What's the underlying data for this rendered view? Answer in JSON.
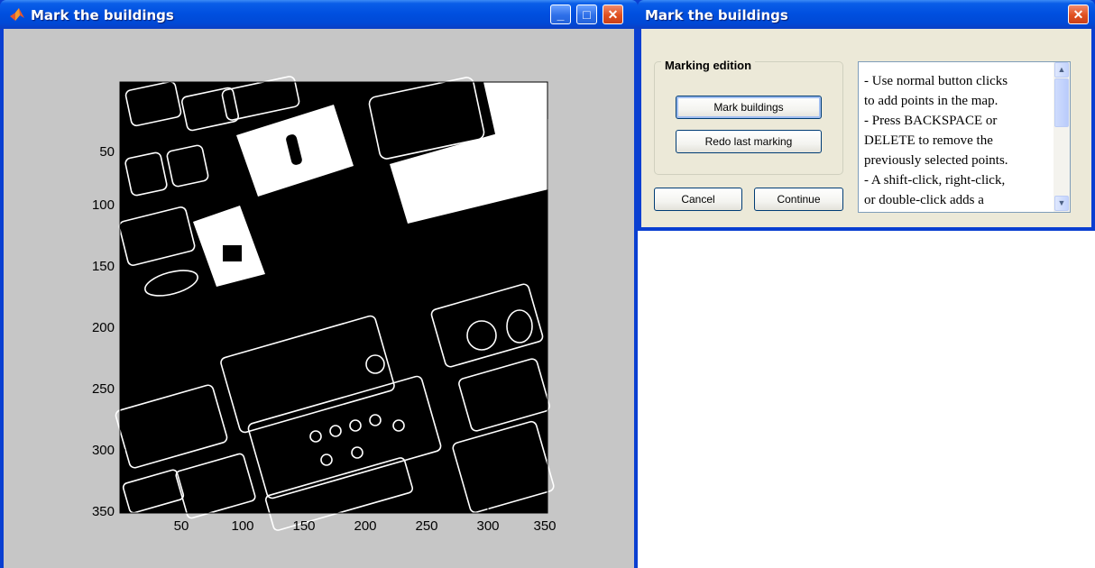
{
  "figure_window": {
    "title": "Mark the buildings",
    "icons": {
      "app": "matlab-icon",
      "minimize": "minimize-icon",
      "maximize": "maximize-icon",
      "close": "close-icon"
    }
  },
  "axes": {
    "x_ticks": [
      "50",
      "100",
      "150",
      "200",
      "250",
      "300",
      "350"
    ],
    "y_ticks": [
      "50",
      "100",
      "150",
      "200",
      "250",
      "300",
      "350"
    ]
  },
  "dialog": {
    "title": "Mark the buildings",
    "group_label": "Marking edition",
    "mark_button": "Mark buildings",
    "redo_button": "Redo last marking",
    "cancel_button": "Cancel",
    "continue_button": "Continue",
    "instructions": [
      "- Use normal button clicks",
      "to add points in the map.",
      "- Press BACKSPACE or",
      "DELETE to remove the",
      "previously selected points.",
      "- A shift-click, right-click,",
      "or double-click adds a"
    ],
    "icons": {
      "close": "close-icon",
      "scroll_up": "scroll-up-icon",
      "scroll_down": "scroll-down-icon"
    }
  },
  "colors": {
    "title_bar": "#0050e0",
    "figure_bg": "#c6c6c6",
    "dialog_bg": "#ece9d8",
    "close_button": "#e0501f"
  }
}
